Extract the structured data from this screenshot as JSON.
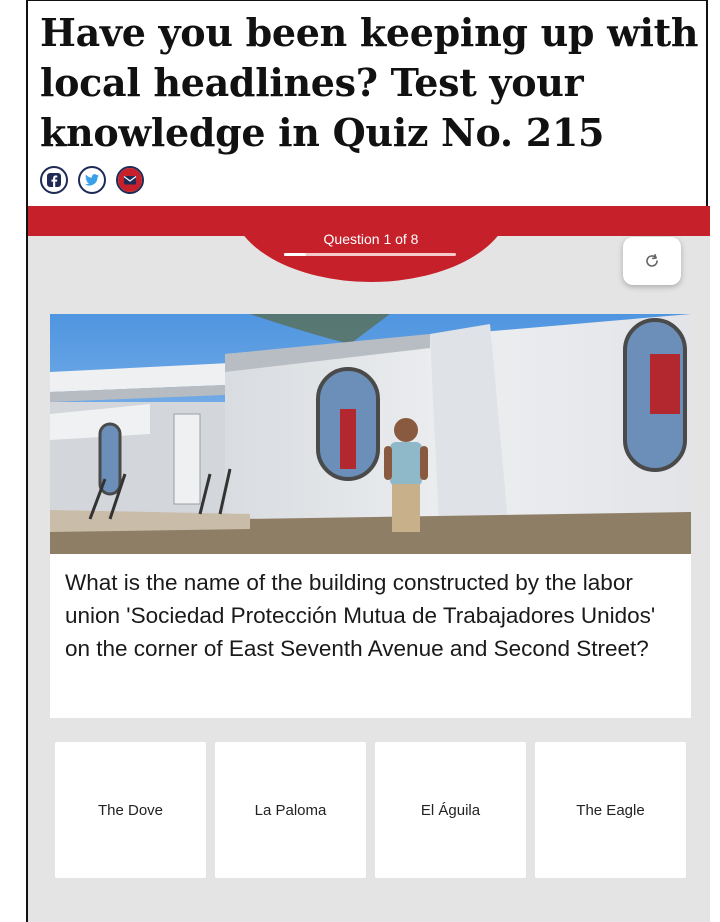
{
  "article": {
    "title": "Have you been keeping up with local headlines? Test your knowledge in Quiz No. 215",
    "share": [
      {
        "icon": "facebook-icon",
        "label": "f"
      },
      {
        "icon": "twitter-icon",
        "label": "t"
      },
      {
        "icon": "email-icon",
        "label": "email"
      }
    ]
  },
  "quiz": {
    "progress_label": "Question 1 of 8",
    "progress_fraction": 0.125,
    "reload_icon": "refresh-icon",
    "question": "What is the name of the building constructed by the labor union 'Sociedad Protección Mutua de Trabajadores Unidos' on the corner of East Seventh Avenue and Second Street?",
    "answers": [
      "The Dove",
      "La Paloma",
      "El Águila",
      "The Eagle"
    ]
  },
  "colors": {
    "accent": "#c6202b",
    "quiz_background": "#e4e4e4",
    "share_border": "#1f2a55"
  }
}
